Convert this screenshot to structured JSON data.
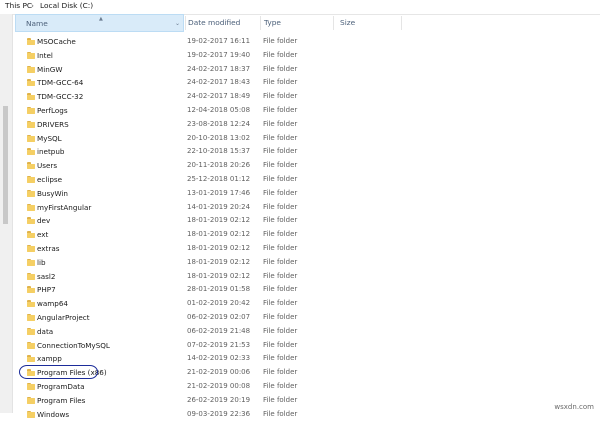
{
  "breadcrumb": {
    "items": [
      "This PC",
      "Local Disk (C:)"
    ],
    "separator": "›"
  },
  "columns": {
    "name": "Name",
    "date": "Date modified",
    "type": "Type",
    "size": "Size"
  },
  "rows": [
    {
      "name": "MSOCache",
      "date": "19-02-2017 16:11",
      "type": "File folder"
    },
    {
      "name": "Intel",
      "date": "19-02-2017 19:40",
      "type": "File folder"
    },
    {
      "name": "MinGW",
      "date": "24-02-2017 18:37",
      "type": "File folder"
    },
    {
      "name": "TDM-GCC-64",
      "date": "24-02-2017 18:43",
      "type": "File folder"
    },
    {
      "name": "TDM-GCC-32",
      "date": "24-02-2017 18:49",
      "type": "File folder"
    },
    {
      "name": "PerfLogs",
      "date": "12-04-2018 05:08",
      "type": "File folder"
    },
    {
      "name": "DRIVERS",
      "date": "23-08-2018 12:24",
      "type": "File folder"
    },
    {
      "name": "MySQL",
      "date": "20-10-2018 13:02",
      "type": "File folder"
    },
    {
      "name": "inetpub",
      "date": "22-10-2018 15:37",
      "type": "File folder"
    },
    {
      "name": "Users",
      "date": "20-11-2018 20:26",
      "type": "File folder"
    },
    {
      "name": "eclipse",
      "date": "25-12-2018 01:12",
      "type": "File folder"
    },
    {
      "name": "BusyWin",
      "date": "13-01-2019 17:46",
      "type": "File folder"
    },
    {
      "name": "myFirstAngular",
      "date": "14-01-2019 20:24",
      "type": "File folder"
    },
    {
      "name": "dev",
      "date": "18-01-2019 02:12",
      "type": "File folder"
    },
    {
      "name": "ext",
      "date": "18-01-2019 02:12",
      "type": "File folder"
    },
    {
      "name": "extras",
      "date": "18-01-2019 02:12",
      "type": "File folder"
    },
    {
      "name": "lib",
      "date": "18-01-2019 02:12",
      "type": "File folder"
    },
    {
      "name": "sasl2",
      "date": "18-01-2019 02:12",
      "type": "File folder"
    },
    {
      "name": "PHP7",
      "date": "28-01-2019 01:58",
      "type": "File folder"
    },
    {
      "name": "wamp64",
      "date": "01-02-2019 20:42",
      "type": "File folder"
    },
    {
      "name": "AngularProject",
      "date": "06-02-2019 02:07",
      "type": "File folder"
    },
    {
      "name": "data",
      "date": "06-02-2019 21:48",
      "type": "File folder"
    },
    {
      "name": "ConnectionToMySQL",
      "date": "07-02-2019 21:53",
      "type": "File folder"
    },
    {
      "name": "xampp",
      "date": "14-02-2019 02:33",
      "type": "File folder"
    },
    {
      "name": "Program Files (x86)",
      "date": "21-02-2019 00:06",
      "type": "File folder"
    },
    {
      "name": "ProgramData",
      "date": "21-02-2019 00:08",
      "type": "File folder"
    },
    {
      "name": "Program Files",
      "date": "26-02-2019 20:19",
      "type": "File folder"
    },
    {
      "name": "Windows",
      "date": "09-03-2019 22:36",
      "type": "File folder"
    }
  ],
  "icons": {
    "folder": "folder-icon",
    "sort": "sort-up-icon",
    "chevron": "chevron-down-icon"
  },
  "colors": {
    "folder": "#f5cf64",
    "header_active": "#d9ebf9",
    "header_text": "#4c607a",
    "annotation": "#1c2c9a"
  },
  "watermark": "wsxdn.com"
}
